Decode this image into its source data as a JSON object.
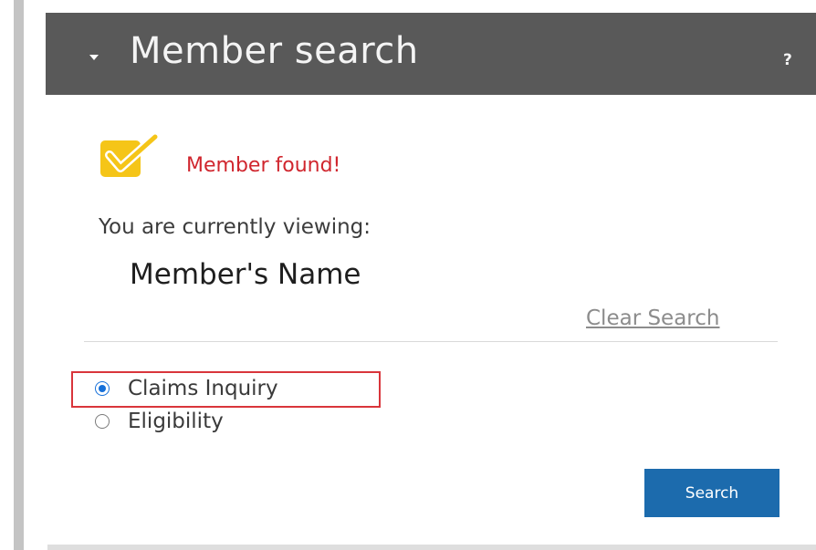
{
  "header": {
    "title": "Member search",
    "help_label": "?"
  },
  "status": {
    "message": "Member found!",
    "icon": "checkmark-badge-icon",
    "message_color": "#d0262e",
    "badge_color": "#f5c518"
  },
  "viewing": {
    "label": "You are currently viewing:",
    "member_name": "Member's Name"
  },
  "actions": {
    "clear_search": "Clear Search",
    "search_button": "Search"
  },
  "options": {
    "selected": "Claims Inquiry",
    "items": [
      {
        "label": "Claims Inquiry",
        "checked": true
      },
      {
        "label": "Eligibility",
        "checked": false
      }
    ]
  },
  "colors": {
    "header_bg": "#595959",
    "accent_blue": "#1c6bad",
    "radio_blue": "#1670d9",
    "highlight_border": "#d9353b"
  }
}
